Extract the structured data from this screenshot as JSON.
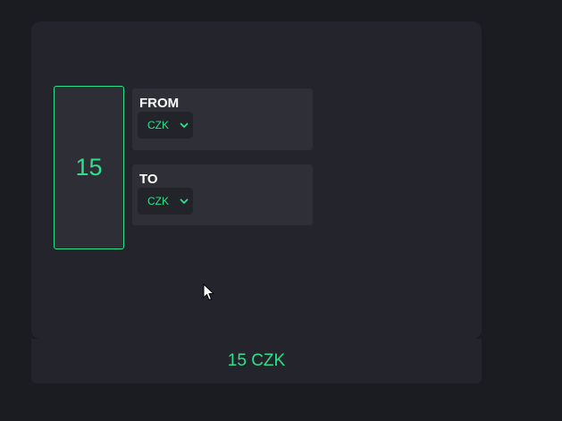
{
  "converter": {
    "amount": "15",
    "from": {
      "label": "FROM",
      "currency": "CZK"
    },
    "to": {
      "label": "TO",
      "currency": "CZK"
    },
    "result": "15 CZK"
  },
  "colors": {
    "accent": "#2ee08a",
    "background": "#1b1b22",
    "card": "#24242c",
    "panel": "#2f2f37"
  },
  "icons": [
    "chevron-down-icon",
    "mouse-cursor-icon"
  ]
}
